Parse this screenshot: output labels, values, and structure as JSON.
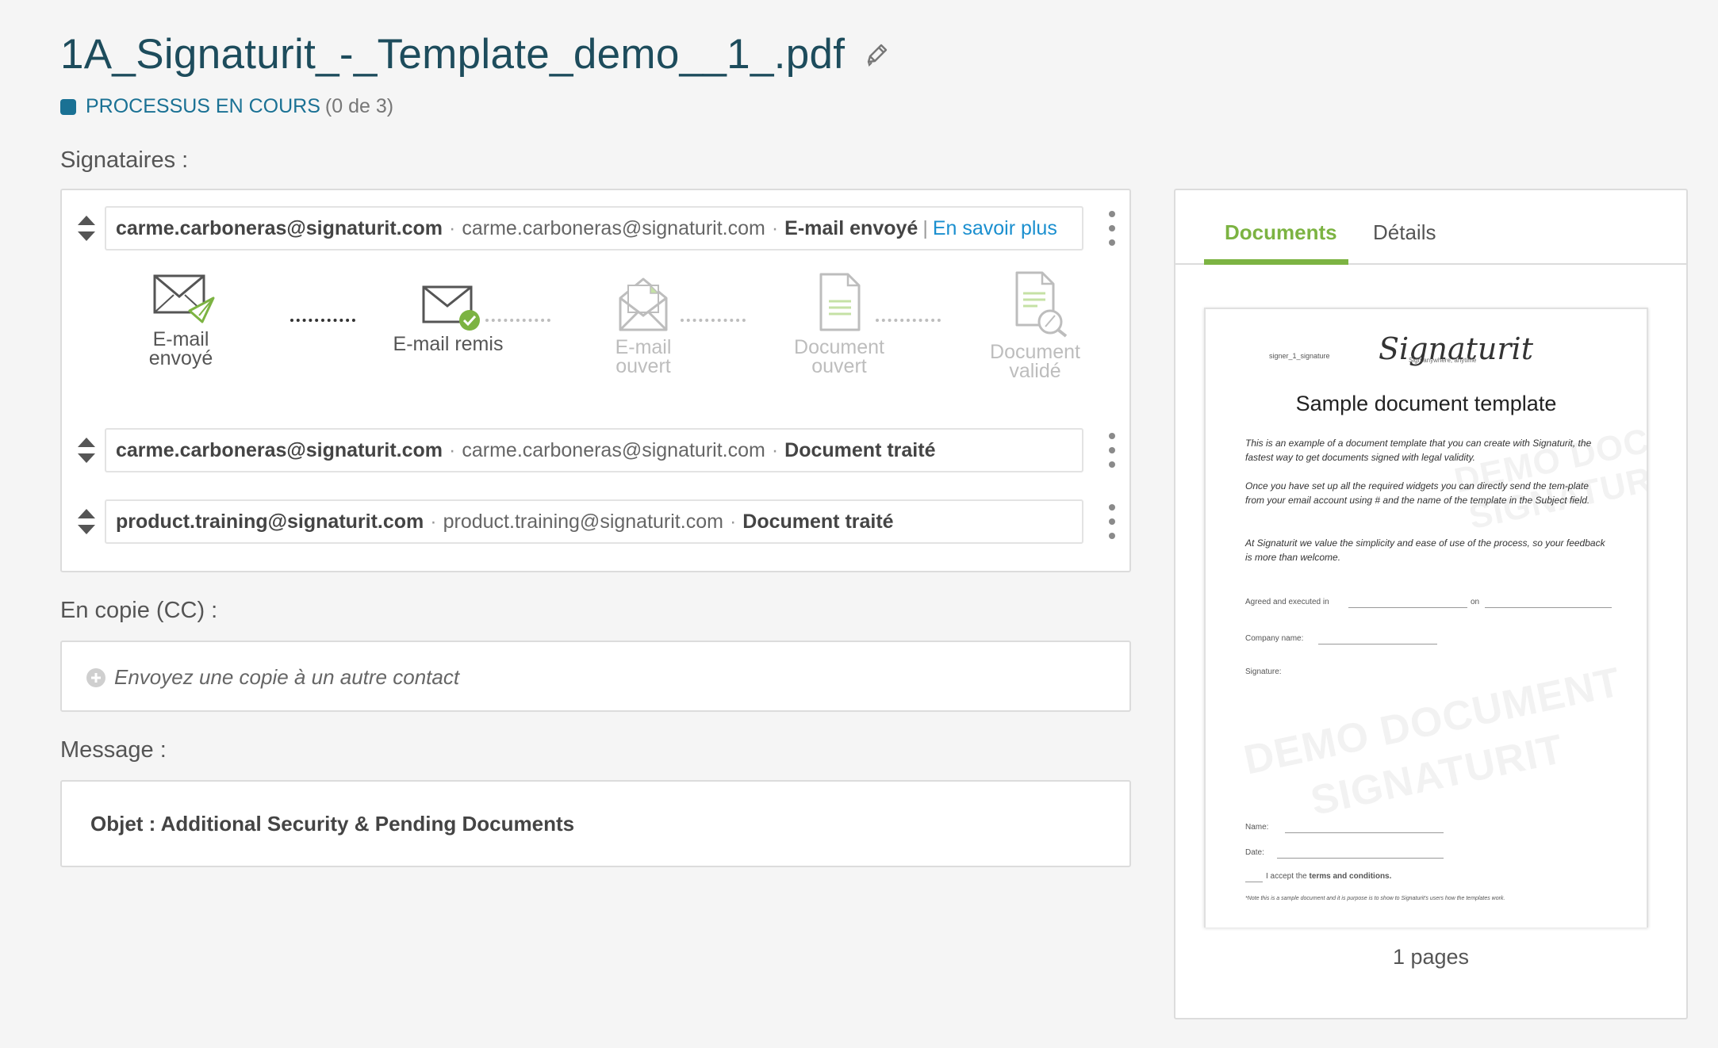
{
  "header": {
    "title": "1A_Signaturit_-_Template_demo__1_.pdf",
    "status_label": "PROCESSUS EN COURS",
    "status_count": "(0 de 3)",
    "status_color": "#1a7194"
  },
  "signers": {
    "label": "Signataires :",
    "rows": [
      {
        "name": "carme.carboneras@signaturit.com",
        "email": "carme.carboneras@signaturit.com",
        "status": "E-mail envoyé",
        "link": "En savoir plus"
      },
      {
        "name": "carme.carboneras@signaturit.com",
        "email": "carme.carboneras@signaturit.com",
        "status": "Document traité"
      },
      {
        "name": "product.training@signaturit.com",
        "email": "product.training@signaturit.com",
        "status": "Document traité"
      }
    ],
    "separator": "·",
    "pipe": "|",
    "steps": [
      {
        "line1": "E-mail",
        "line2": "envoyé",
        "icon": "envelope-sent-icon",
        "state": "active"
      },
      {
        "line1": "E-mail remis",
        "line2": "",
        "icon": "envelope-delivered-icon",
        "state": "active"
      },
      {
        "line1": "E-mail",
        "line2": "ouvert",
        "icon": "envelope-open-icon",
        "state": "inactive"
      },
      {
        "line1": "Document",
        "line2": "ouvert",
        "icon": "document-icon",
        "state": "inactive"
      },
      {
        "line1": "Document",
        "line2": "validé",
        "icon": "document-validated-icon",
        "state": "inactive"
      }
    ]
  },
  "cc": {
    "label": "En copie (CC) :",
    "placeholder": "Envoyez une copie à un autre contact"
  },
  "message": {
    "label": "Message :",
    "subject": "Objet : Additional Security & Pending Documents"
  },
  "panel": {
    "tabs": [
      {
        "label": "Documents",
        "active": true
      },
      {
        "label": "Détails",
        "active": false
      }
    ],
    "accent_color": "#7cb342",
    "pages_label": "1 pages",
    "preview": {
      "signer_tag": "signer_1_signature",
      "logo": "Signaturit",
      "tagline": "Sign anywhere, anytime",
      "heading": "Sample document template",
      "para1": "This is an example of a document template that you can create with Signaturit, the fastest way to get documents signed with legal validity.",
      "para2": "Once you have set up all the required widgets you can directly send the tem-plate from your email account using # and the name of the template in the Subject field.",
      "para3": "At Signaturit we value the simplicity and ease of use of the process, so your feedback is more than welcome.",
      "agreed": "Agreed and executed in",
      "on": "on",
      "company": "Company name:",
      "signature": "Signature:",
      "name": "Name:",
      "date": "Date:",
      "accept": "I accept the",
      "terms": "terms and conditions.",
      "note": "*Note this is a sample document and it is purpose is to show to Signaturit's users how the templates work.",
      "watermark1": "DEMO DOCUMENT",
      "watermark2": "SIGNATURIT"
    }
  }
}
